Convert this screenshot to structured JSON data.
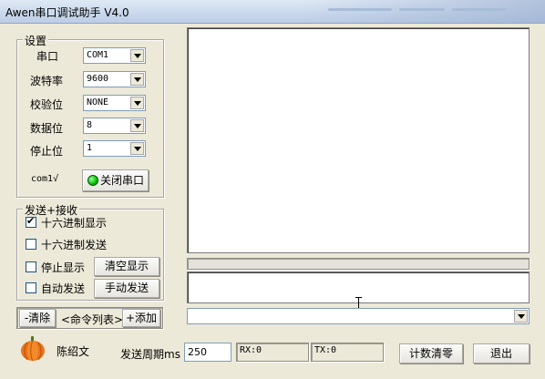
{
  "window": {
    "title": "Awen串口调试助手 V4.0"
  },
  "settings": {
    "group_label": "设置",
    "rows": [
      {
        "label": "串口",
        "value": "COM1"
      },
      {
        "label": "波特率",
        "value": "9600"
      },
      {
        "label": "校验位",
        "value": "NONE"
      },
      {
        "label": "数据位",
        "value": "8"
      },
      {
        "label": "停止位",
        "value": "1"
      }
    ],
    "port_status": "com1√",
    "port_button": "关闭串口",
    "indicator_color": "#00d000"
  },
  "sendrecv": {
    "group_label": "发送+接收",
    "hex_display": {
      "label": "十六进制显示",
      "checked": true
    },
    "hex_send": {
      "label": "十六进制发送",
      "checked": false
    },
    "stop_display": {
      "label": "停止显示",
      "checked": false
    },
    "auto_send": {
      "label": "自动发送",
      "checked": false
    },
    "clear_button": "清空显示",
    "manual_button": "手动发送"
  },
  "command_bar": {
    "clear": "-清除",
    "list": "<命令列表>",
    "add": "+添加"
  },
  "bottom": {
    "author": "陈绍文",
    "period_label": "发送周期ms",
    "period_value": "250",
    "rx": "RX:0",
    "tx": "TX:0",
    "reset_button": "计数清零",
    "exit_button": "退出"
  }
}
